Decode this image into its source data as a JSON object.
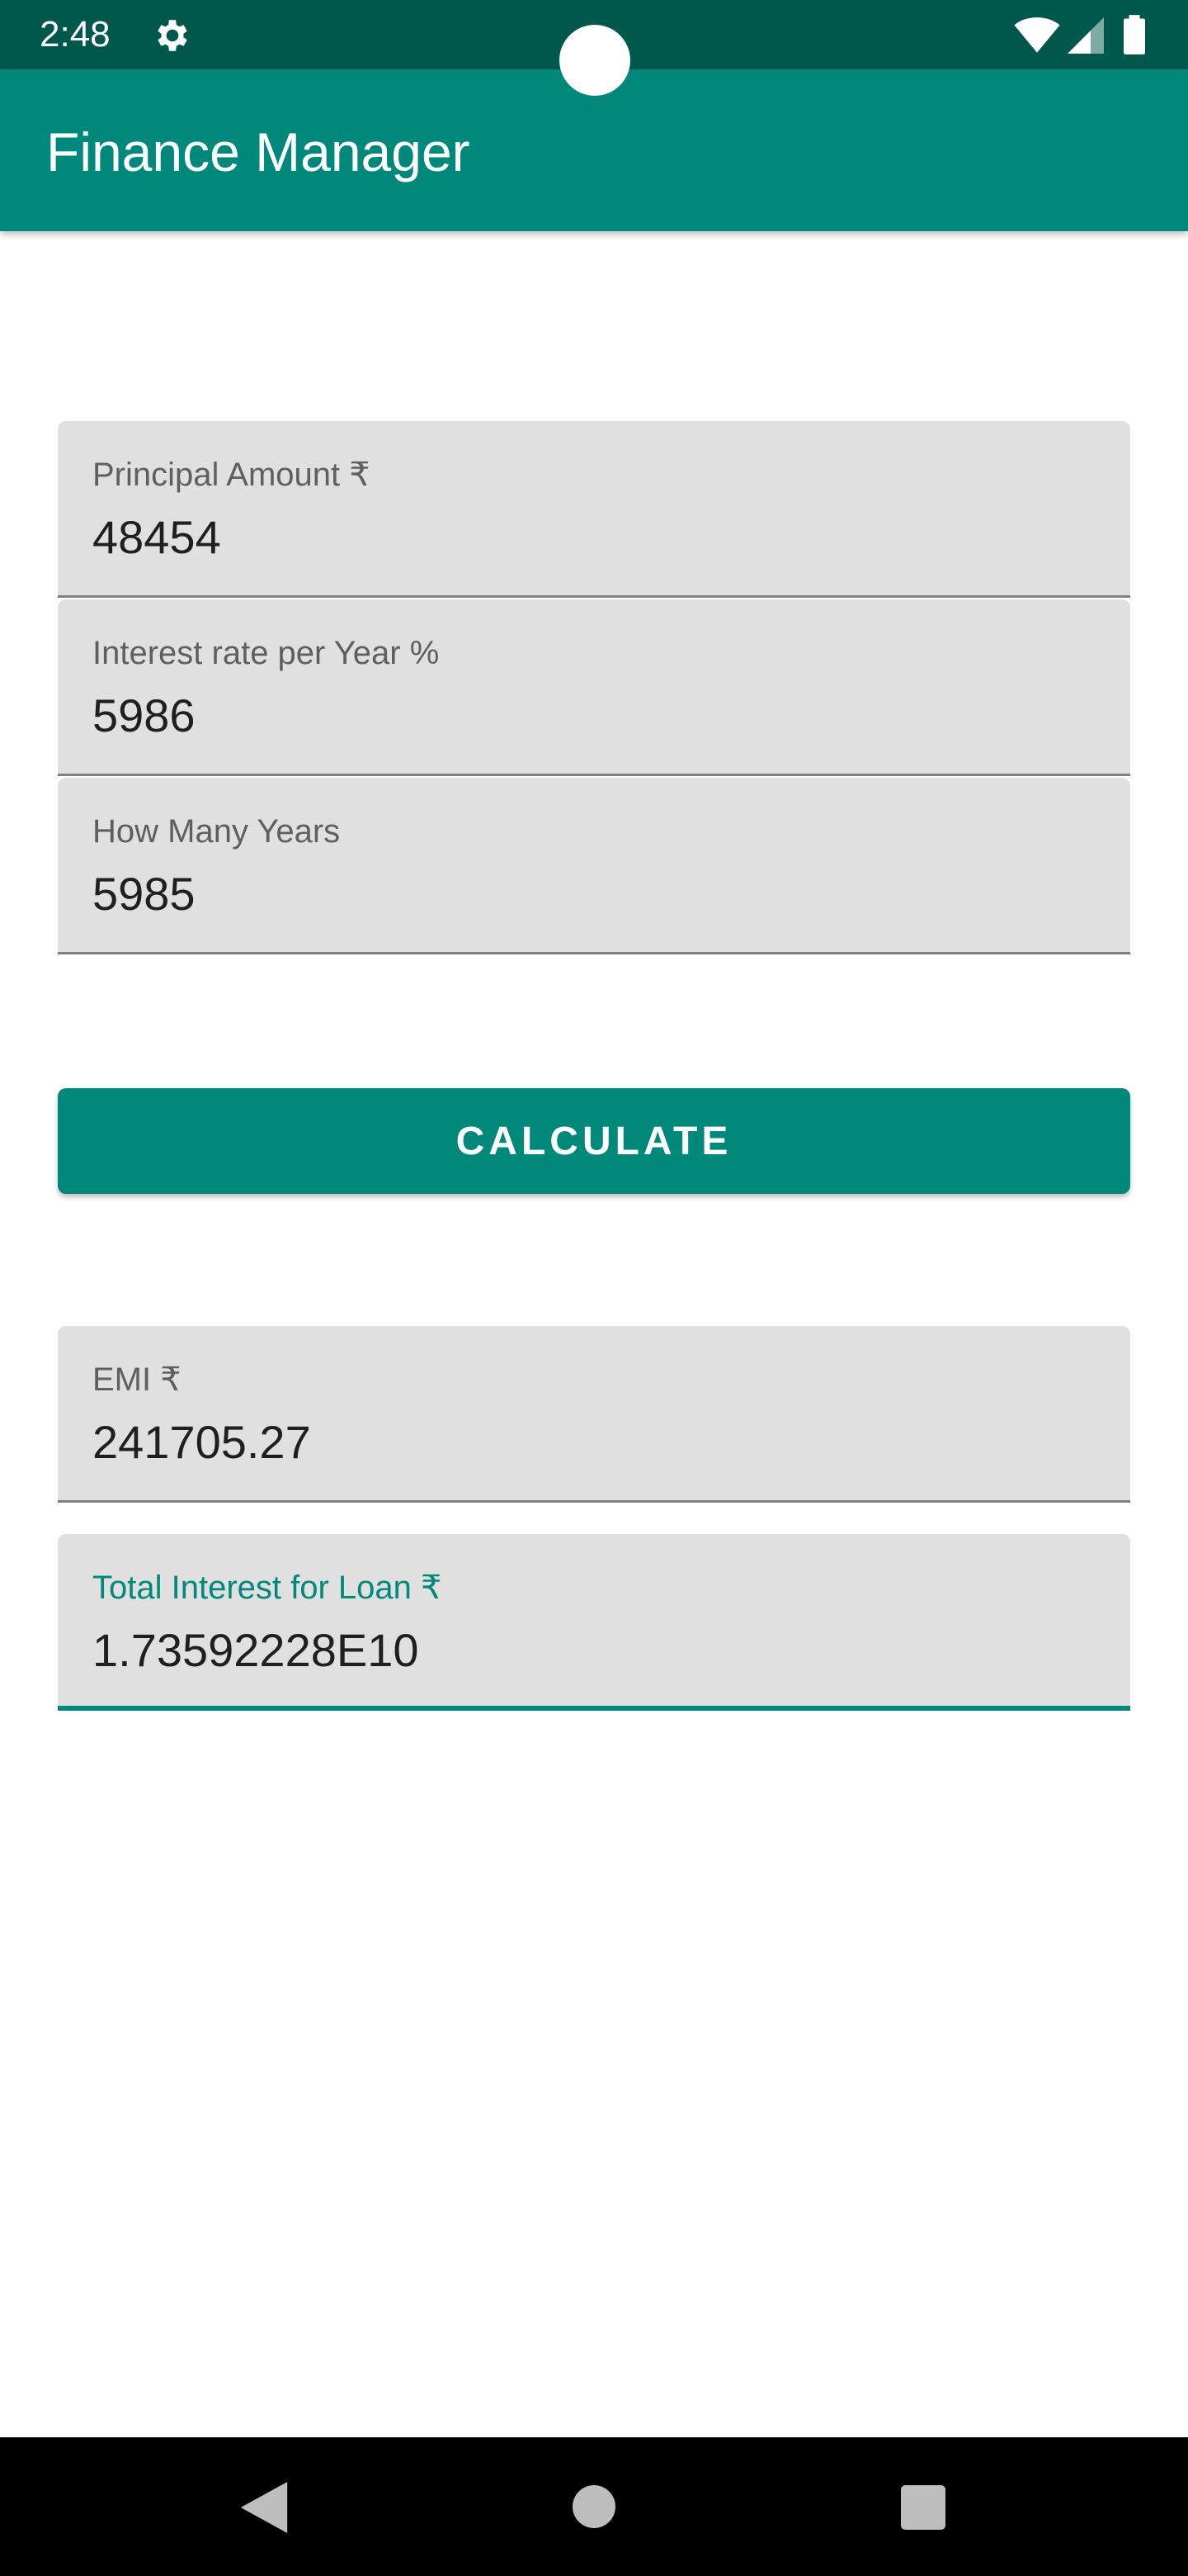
{
  "status_bar": {
    "time": "2:48",
    "icons": [
      "gear-icon",
      "wifi-icon",
      "signal-icon",
      "battery-icon"
    ]
  },
  "app_bar": {
    "title": "Finance Manager"
  },
  "form": {
    "principal": {
      "label": "Principal Amount ₹",
      "value": "48454"
    },
    "interest_rate": {
      "label": "Interest rate per Year %",
      "value": "5986"
    },
    "years": {
      "label": "How Many Years",
      "value": "5985"
    }
  },
  "calculate_button": {
    "label": "CALCULATE"
  },
  "results": {
    "emi": {
      "label": "EMI ₹",
      "value": "241705.27"
    },
    "total_interest": {
      "label": "Total Interest for Loan ₹",
      "value": "1.73592228E10"
    }
  },
  "nav_bar": {
    "icons": [
      "back-icon",
      "home-icon",
      "recents-icon"
    ]
  },
  "colors": {
    "status_bar": "#00574b",
    "app_bar": "#00897b",
    "accent": "#00897b",
    "field_bg": "#e0e0e0",
    "nav_bar": "#000000"
  }
}
